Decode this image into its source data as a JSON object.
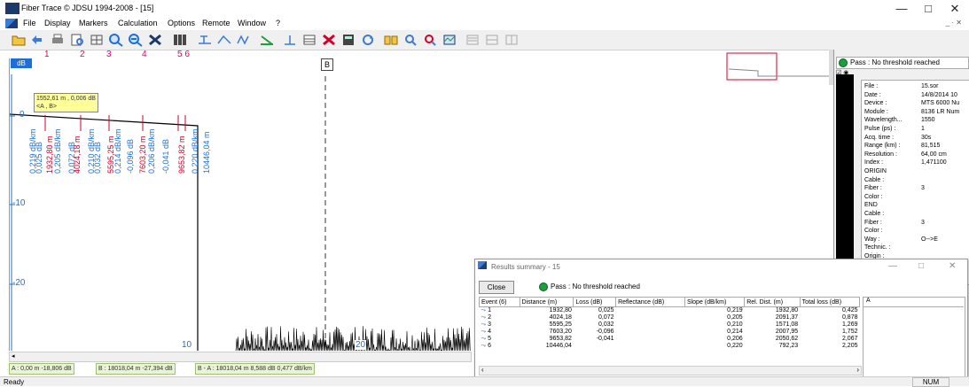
{
  "window": {
    "title": "Fiber Trace © JDSU 1994-2008 - [15]",
    "controls": [
      "—",
      "□",
      "✕"
    ],
    "mdi_controls": "_ · ✕"
  },
  "menu": [
    "File",
    "Display",
    "Markers",
    "Calculation",
    "Options",
    "Remote",
    "Window",
    "?"
  ],
  "toolbar_icons": [
    "open-file-icon",
    "navigate-icon",
    "print-icon",
    "preview-icon",
    "grid-icon",
    "zoom-in-icon",
    "zoom-out-icon",
    "tools-icon",
    "barcode-icon",
    "marker-a-icon",
    "marker-b-icon",
    "marker-ab-icon",
    "slope-icon",
    "splice-icon",
    "table-icon",
    "delete-icon",
    "calc-icon",
    "refresh-icon",
    "compare-icon",
    "zoom-area-icon",
    "zoom-fit-icon",
    "overlay-icon",
    "multi-trace-icon",
    "grid2-icon",
    "grid3-icon"
  ],
  "ruler": {
    "labels": [
      "1",
      "2",
      "3",
      "4",
      "5 6"
    ],
    "marker_b": "B"
  },
  "plot": {
    "unit_badge": "dB",
    "tooltip_line1": "1552,61 m , 0,006 dB",
    "tooltip_line2": "<A , B>",
    "y_labels": [
      "0",
      "-10",
      "-20"
    ],
    "x_labels": [
      "10",
      "20"
    ],
    "event_labels": [
      "0,219 dB/km",
      "0,025 dB",
      "1932,80 m",
      "0,205 dB/km",
      "0,072 dB",
      "4024,18 m",
      "0,210 dB/km",
      "0,032 dB",
      "5595,25 m",
      "0,214 dB/km",
      "-0,096 dB",
      "7603,20 m",
      "0,206 dB/km",
      "-0,041 dB",
      "9653,82 m",
      "0,220 dB/km",
      "10446,04 m"
    ],
    "colors": {
      "red": "#d4002a",
      "blue": "#1d6fd6",
      "pink": "#e0006a"
    }
  },
  "status_info": [
    "A : 0,00 m  -18,806 dB",
    "B : 18018,04 m  -27,394 dB",
    "B - A : 18018,04 m  8,588 dB 0,477 dB/km"
  ],
  "status_bar": {
    "ready": "Ready",
    "num": "NUM"
  },
  "right_panel": {
    "pass_text": "Pass : No threshold reached",
    "meta": [
      {
        "k": "File :",
        "v": "15.sor"
      },
      {
        "k": "Date :",
        "v": "14/8/2014 10"
      },
      {
        "k": "Device :",
        "v": "MTS 6000 Nu"
      },
      {
        "k": "Module :",
        "v": "8136 LR Num"
      },
      {
        "k": "Wavelength...",
        "v": "1550"
      },
      {
        "k": "Pulse (ps) :",
        "v": "1"
      },
      {
        "k": "Acq. time :",
        "v": "30s"
      },
      {
        "k": "Range (km) :",
        "v": "81,515"
      },
      {
        "k": "Resolution :",
        "v": "64,00 cm"
      },
      {
        "k": "Index :",
        "v": "1,471100"
      },
      {
        "k": "ORIGIN",
        "v": ""
      },
      {
        "k": "  Cable :",
        "v": ""
      },
      {
        "k": "  Fiber :",
        "v": "3"
      },
      {
        "k": "  Color :",
        "v": ""
      },
      {
        "k": "END",
        "v": ""
      },
      {
        "k": "  Cable :",
        "v": ""
      },
      {
        "k": "  Fiber :",
        "v": "3"
      },
      {
        "k": "  Color :",
        "v": ""
      },
      {
        "k": "Way :",
        "v": "O-->E"
      },
      {
        "k": "Technic. :",
        "v": ""
      },
      {
        "k": "Origin :",
        "v": ""
      },
      {
        "k": "End :",
        "v": ""
      },
      {
        "k": "Comment :",
        "v": ""
      }
    ]
  },
  "results": {
    "title": "Results summary - 15",
    "close_label": "Close",
    "pass_text": "Pass : No threshold reached",
    "side_header": "A",
    "columns": [
      "Event (6)",
      "Distance (m)",
      "Loss (dB)",
      "Reflectance (dB)",
      "Slope (dB/km)",
      "Rel. Dist. (m)",
      "Total loss (dB)"
    ],
    "rows": [
      [
        "1",
        "1932,80",
        "0,025",
        "",
        "0,219",
        "1932,80",
        "0,425"
      ],
      [
        "2",
        "4024,18",
        "0,072",
        "",
        "0,205",
        "2091,37",
        "0,878"
      ],
      [
        "3",
        "5595,25",
        "0,032",
        "",
        "0,210",
        "1571,08",
        "1,269"
      ],
      [
        "4",
        "7603,20",
        "-0,096",
        "",
        "0,214",
        "2007,95",
        "1,752"
      ],
      [
        "5",
        "9653,82",
        "-0,041",
        "",
        "0,206",
        "2050,62",
        "2,067"
      ],
      [
        "6",
        "10446,04",
        "",
        "",
        "0,220",
        "792,23",
        "2,205"
      ]
    ]
  }
}
